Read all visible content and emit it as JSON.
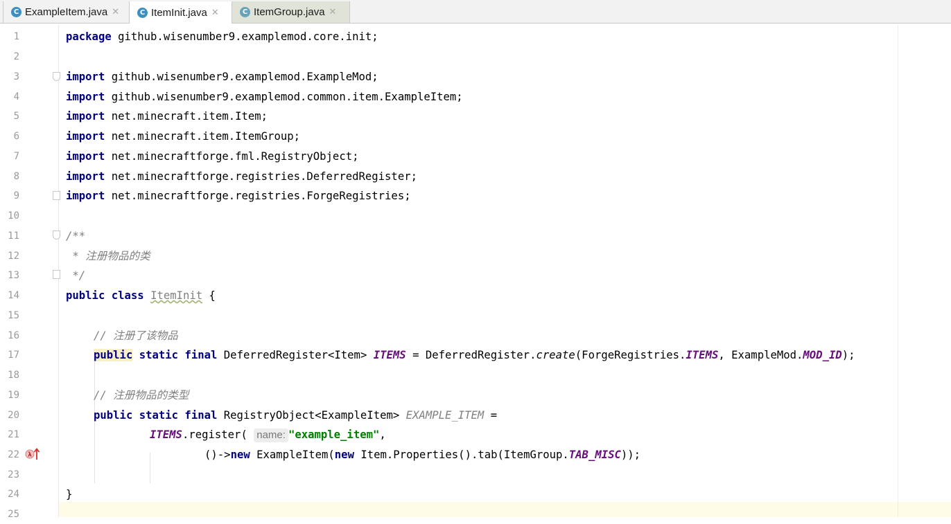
{
  "tabs": [
    {
      "label": "ExampleItem.java",
      "icon": "class-icon"
    },
    {
      "label": "ItemInit.java",
      "icon": "class-icon"
    },
    {
      "label": "ItemGroup.java",
      "icon": "class-icon"
    }
  ],
  "tab_close": "✕",
  "line_numbers": [
    "1",
    "2",
    "3",
    "4",
    "5",
    "6",
    "7",
    "8",
    "9",
    "10",
    "11",
    "12",
    "13",
    "14",
    "15",
    "16",
    "17",
    "18",
    "19",
    "20",
    "21",
    "22",
    "23",
    "24",
    "25"
  ],
  "code": {
    "l1_kw": "package",
    "l1_rest": " github.wisenumber9.examplemod.core.init;",
    "import_kw": "import",
    "l3": " github.wisenumber9.examplemod.ExampleMod;",
    "l4": " github.wisenumber9.examplemod.common.item.ExampleItem;",
    "l5": " net.minecraft.item.Item;",
    "l6": " net.minecraft.item.ItemGroup;",
    "l7": " net.minecraftforge.fml.RegistryObject;",
    "l8": " net.minecraftforge.registries.DeferredRegister;",
    "l9": " net.minecraftforge.registries.ForgeRegistries;",
    "l11": "/**",
    "l12": " * 注册物品的类",
    "l13": " */",
    "l14_kw": "public class",
    "l14_cls": "ItemInit",
    "l14_rest": " {",
    "l16": "// 注册了该物品",
    "kw_public": "public",
    "kw_static_final": " static final",
    "l17_a": " DeferredRegister<Item> ",
    "l17_items": "ITEMS",
    "l17_b": " = DeferredRegister.",
    "l17_create": "create",
    "l17_c": "(ForgeRegistries.",
    "l17_d": ", ExampleMod.",
    "l17_modid": "MOD_ID",
    "l17_e": ");",
    "l19": "// 注册物品的类型",
    "kw_public_static_final": "public static final",
    "l20_a": " RegistryObject<ExampleItem> ",
    "l20_field": "EXAMPLE_ITEM",
    "l20_b": " =",
    "l21_items": "ITEMS",
    "l21_a": ".register( ",
    "l21_hint": "name:",
    "l21_str": "\"example_item\"",
    "l21_b": ",",
    "l22_a": "()->",
    "kw_new": "new",
    "l22_b": " ExampleItem(",
    "l22_c": " Item.Properties().tab(ItemGroup.",
    "l22_tab": "TAB_MISC",
    "l22_d": "));",
    "l24": "}"
  },
  "gutter_icon": "lambda-override-icon",
  "colors": {
    "keyword": "#000080",
    "comment": "#808080",
    "string": "#008000",
    "static_field": "#660e7a"
  }
}
